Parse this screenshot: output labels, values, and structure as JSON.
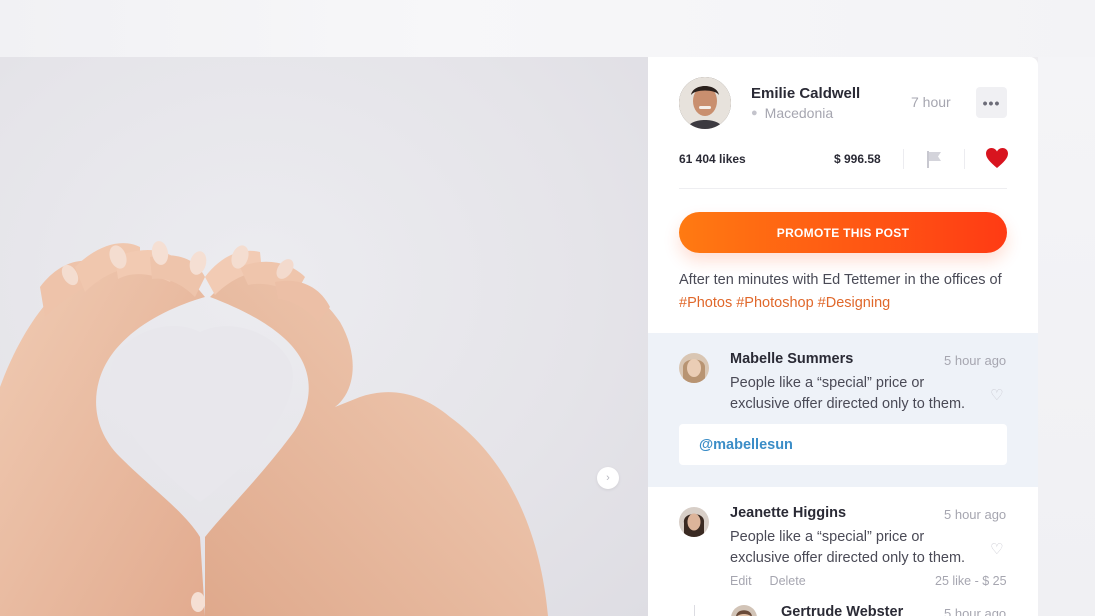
{
  "post": {
    "author_name": "Emilie Caldwell",
    "location": "Macedonia",
    "time_ago": "7 hour",
    "more_label": "•••",
    "likes": "61 404 likes",
    "price": "$ 996.58",
    "promote_label": "PROMOTE THIS POST",
    "caption": "After ten minutes with Ed Tettemer in the offices of",
    "hashtags": "#Photos #Photoshop #Designing"
  },
  "comments": [
    {
      "name": "Mabelle Summers",
      "time": "5 hour ago",
      "text": "People like a “special” price or exclusive offer directed only to them.",
      "reply_mention": "@mabellesun"
    },
    {
      "name": "Jeanette Higgins",
      "time": "5 hour ago",
      "text": "People like a “special” price or exclusive offer directed only to them.",
      "edit_label": "Edit",
      "delete_label": "Delete",
      "meta": "25 like - $ 25"
    },
    {
      "name": "Gertrude Webster",
      "time": "5 hour ago"
    }
  ],
  "colors": {
    "accent_orange": "#ff5a14",
    "heart_red": "#d8141f",
    "hashtag": "#e0682b",
    "mention": "#3b8dc7"
  },
  "icons": {
    "location": "map-pin-icon",
    "flag": "flag-icon",
    "heart": "heart-icon",
    "like": "heart-outline-icon",
    "next": "chevron-right-icon"
  }
}
